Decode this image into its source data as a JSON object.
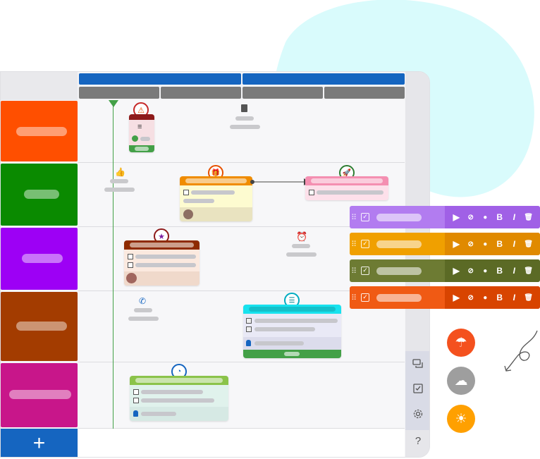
{
  "colors": {
    "header_blue": "#1565c0",
    "header_gray": "#7a7a7a",
    "today_line": "#43a047",
    "blob": "#d9fbfc"
  },
  "rows": [
    {
      "color": "#ff4f00"
    },
    {
      "color": "#0a8a00"
    },
    {
      "color": "#9d00f5"
    },
    {
      "color": "#a33c00"
    },
    {
      "color": "#c8168a"
    }
  ],
  "add_row": {
    "label": "+"
  },
  "sidebar": {
    "icons": [
      "chat-icon",
      "checklist-icon",
      "gear-icon",
      "help-icon"
    ],
    "help_label": "?"
  },
  "cards": {
    "warning": {
      "badge_glyph": "⚠"
    },
    "gift": {
      "badge_glyph": "🎁"
    },
    "rocket": {
      "badge_glyph": "🚀"
    },
    "star": {
      "badge_glyph": "★"
    },
    "tasks": {
      "badge_glyph": "☰"
    },
    "pie": {
      "badge_glyph": "◔"
    }
  },
  "style_panel": [
    {
      "color": "#b27cf0",
      "tools_color": "#a060e6"
    },
    {
      "color": "#f0a000",
      "tools_color": "#e08a00"
    },
    {
      "color": "#6d7b33",
      "tools_color": "#5b6a25"
    },
    {
      "color": "#f05a14",
      "tools_color": "#d84400"
    }
  ],
  "style_tools": {
    "play": "▶",
    "hide": "⊘",
    "fill": "●",
    "bold": "B",
    "italic": "I",
    "delete": "🗑"
  },
  "weather_buttons": [
    {
      "name": "rain",
      "glyph": "☂",
      "color": "#f4511e"
    },
    {
      "name": "cloudy",
      "glyph": "☁",
      "color": "#9e9e9e"
    },
    {
      "name": "sunny",
      "glyph": "☀",
      "color": "#ffa000"
    }
  ]
}
